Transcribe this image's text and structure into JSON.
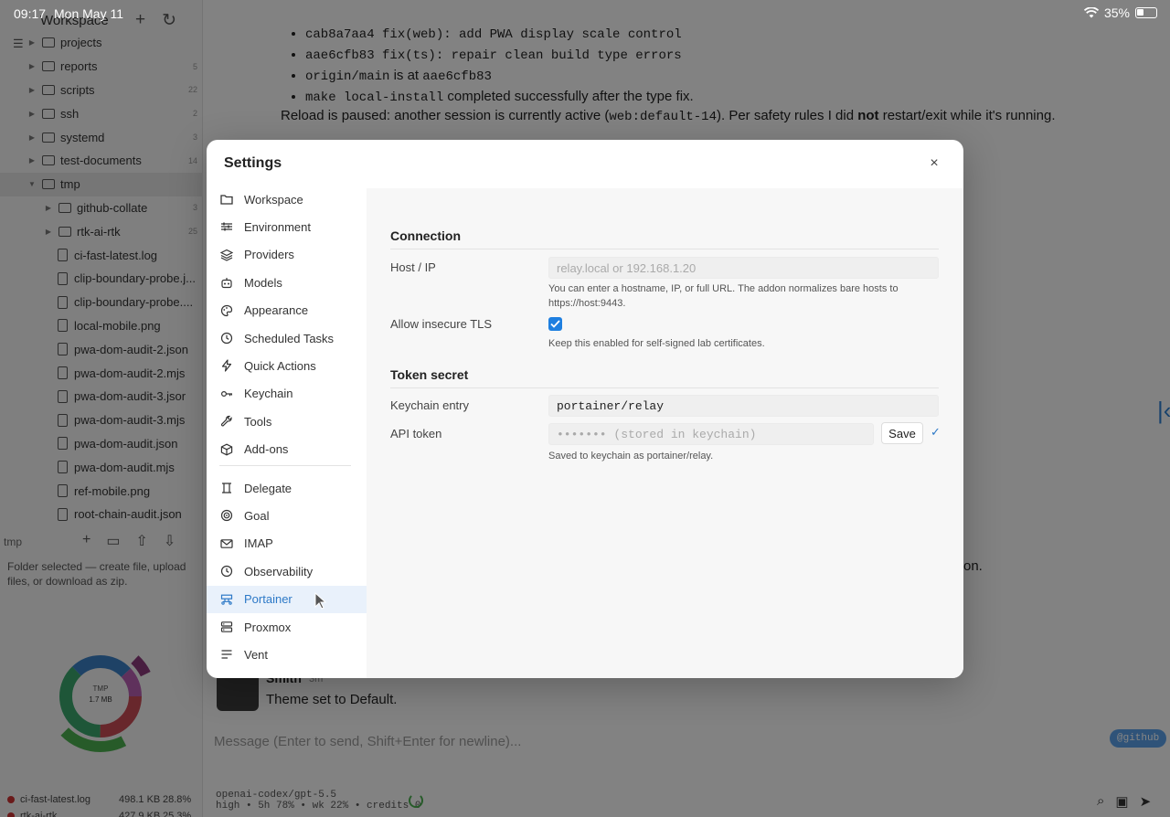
{
  "statusbar": {
    "time": "09:17",
    "date": "Mon May 11",
    "battery": "35%"
  },
  "sidebar": {
    "title": "Workspace",
    "tree": [
      {
        "name": "projects",
        "type": "folder",
        "count": "",
        "expanded": false,
        "indent": 0
      },
      {
        "name": "reports",
        "type": "folder",
        "count": "5",
        "expanded": false,
        "indent": 0
      },
      {
        "name": "scripts",
        "type": "folder",
        "count": "22",
        "expanded": false,
        "indent": 0
      },
      {
        "name": "ssh",
        "type": "folder",
        "count": "2",
        "expanded": false,
        "indent": 0
      },
      {
        "name": "systemd",
        "type": "folder",
        "count": "3",
        "expanded": false,
        "indent": 0
      },
      {
        "name": "test-documents",
        "type": "folder",
        "count": "14",
        "expanded": false,
        "indent": 0
      },
      {
        "name": "tmp",
        "type": "folder",
        "count": "",
        "expanded": true,
        "indent": 0,
        "selected": true
      },
      {
        "name": "github-collate",
        "type": "folder",
        "count": "3",
        "expanded": false,
        "indent": 1
      },
      {
        "name": "rtk-ai-rtk",
        "type": "folder",
        "count": "25",
        "expanded": false,
        "indent": 1
      },
      {
        "name": "ci-fast-latest.log",
        "type": "file",
        "count": "",
        "indent": 1
      },
      {
        "name": "clip-boundary-probe.j...",
        "type": "file",
        "count": "",
        "indent": 1
      },
      {
        "name": "clip-boundary-probe....",
        "type": "file",
        "count": "",
        "indent": 1
      },
      {
        "name": "local-mobile.png",
        "type": "file",
        "count": "",
        "indent": 1
      },
      {
        "name": "pwa-dom-audit-2.json",
        "type": "file",
        "count": "",
        "indent": 1
      },
      {
        "name": "pwa-dom-audit-2.mjs",
        "type": "file",
        "count": "",
        "indent": 1
      },
      {
        "name": "pwa-dom-audit-3.jsor",
        "type": "file",
        "count": "",
        "indent": 1
      },
      {
        "name": "pwa-dom-audit-3.mjs",
        "type": "file",
        "count": "",
        "indent": 1
      },
      {
        "name": "pwa-dom-audit.json",
        "type": "file",
        "count": "",
        "indent": 1
      },
      {
        "name": "pwa-dom-audit.mjs",
        "type": "file",
        "count": "",
        "indent": 1
      },
      {
        "name": "ref-mobile.png",
        "type": "file",
        "count": "",
        "indent": 1
      },
      {
        "name": "root-chain-audit.json",
        "type": "file",
        "count": "",
        "indent": 1
      }
    ],
    "bar_label": "tmp",
    "hint": "Folder selected — create file, upload files, or download as zip.",
    "sunburst_label": "TMP",
    "sunburst_size": "1.7 MB",
    "footer": [
      {
        "name": "ci-fast-latest.log",
        "size": "498.1 KB",
        "pct": "28.8%"
      },
      {
        "name": "rtk-ai-rtk",
        "size": "427.9 KB",
        "pct": "25.3%"
      }
    ]
  },
  "chat": {
    "bullets": [
      {
        "code": "cab8a7aa4 fix(web): add PWA display scale control",
        "text": ""
      },
      {
        "code": "aae6cfb83 fix(ts): repair clean build type errors",
        "text": ""
      },
      {
        "code": "origin/main",
        "text": " is at ",
        "code2": "aae6cfb83"
      },
      {
        "code": "make local-install",
        "text": " completed successfully after the type fix."
      }
    ],
    "para_a": "Reload is paused: another session is currently active (",
    "para_code": "web:default-14",
    "para_b": "). Per safety rules I did ",
    "para_bold": "not",
    "para_c": " restart/exit while it's running.",
    "trail": "on.",
    "author": "Smith",
    "author_time": "3m",
    "message": "Theme set to Default.",
    "composer_placeholder": "Message (Enter to send, Shift+Enter for newline)...",
    "mention": "@github",
    "model_line1": "openai-codex/gpt-5.5",
    "model_line2": "high • 5h 78% • wk 22% • credits 0"
  },
  "settings": {
    "title": "Settings",
    "close": "×",
    "nav": [
      {
        "label": "Workspace",
        "icon": "folder-icon"
      },
      {
        "label": "Environment",
        "icon": "sliders-icon"
      },
      {
        "label": "Providers",
        "icon": "layers-icon"
      },
      {
        "label": "Models",
        "icon": "robot-icon"
      },
      {
        "label": "Appearance",
        "icon": "palette-icon"
      },
      {
        "label": "Scheduled Tasks",
        "icon": "clock-icon"
      },
      {
        "label": "Quick Actions",
        "icon": "bolt-icon"
      },
      {
        "label": "Keychain",
        "icon": "key-icon"
      },
      {
        "label": "Tools",
        "icon": "wrench-icon"
      },
      {
        "label": "Add-ons",
        "icon": "package-icon"
      },
      {
        "label": "Delegate",
        "icon": "delegate-icon"
      },
      {
        "label": "Goal",
        "icon": "target-icon"
      },
      {
        "label": "IMAP",
        "icon": "mail-icon"
      },
      {
        "label": "Observability",
        "icon": "clock-icon"
      },
      {
        "label": "Portainer",
        "icon": "portainer-icon",
        "active": true
      },
      {
        "label": "Proxmox",
        "icon": "server-icon"
      },
      {
        "label": "Vent",
        "icon": "lines-icon"
      }
    ],
    "connection": {
      "title": "Connection",
      "host_label": "Host / IP",
      "host_value": "",
      "host_placeholder": "relay.local or 192.168.1.20",
      "host_help": "You can enter a hostname, IP, or full URL. The addon normalizes bare hosts to https://host:9443.",
      "tls_label": "Allow insecure TLS",
      "tls_checked": true,
      "tls_help": "Keep this enabled for self-signed lab certificates."
    },
    "token": {
      "title": "Token secret",
      "entry_label": "Keychain entry",
      "entry_value": "portainer/relay",
      "api_label": "API token",
      "api_placeholder": "••••••• (stored in keychain)",
      "save_label": "Save",
      "saved_check": "✓",
      "help": "Saved to keychain as portainer/relay."
    }
  },
  "colors": {
    "accent": "#2d79c7",
    "checkbox": "#1e7fe0",
    "overlay": "rgba(0,0,0,0.48)"
  }
}
